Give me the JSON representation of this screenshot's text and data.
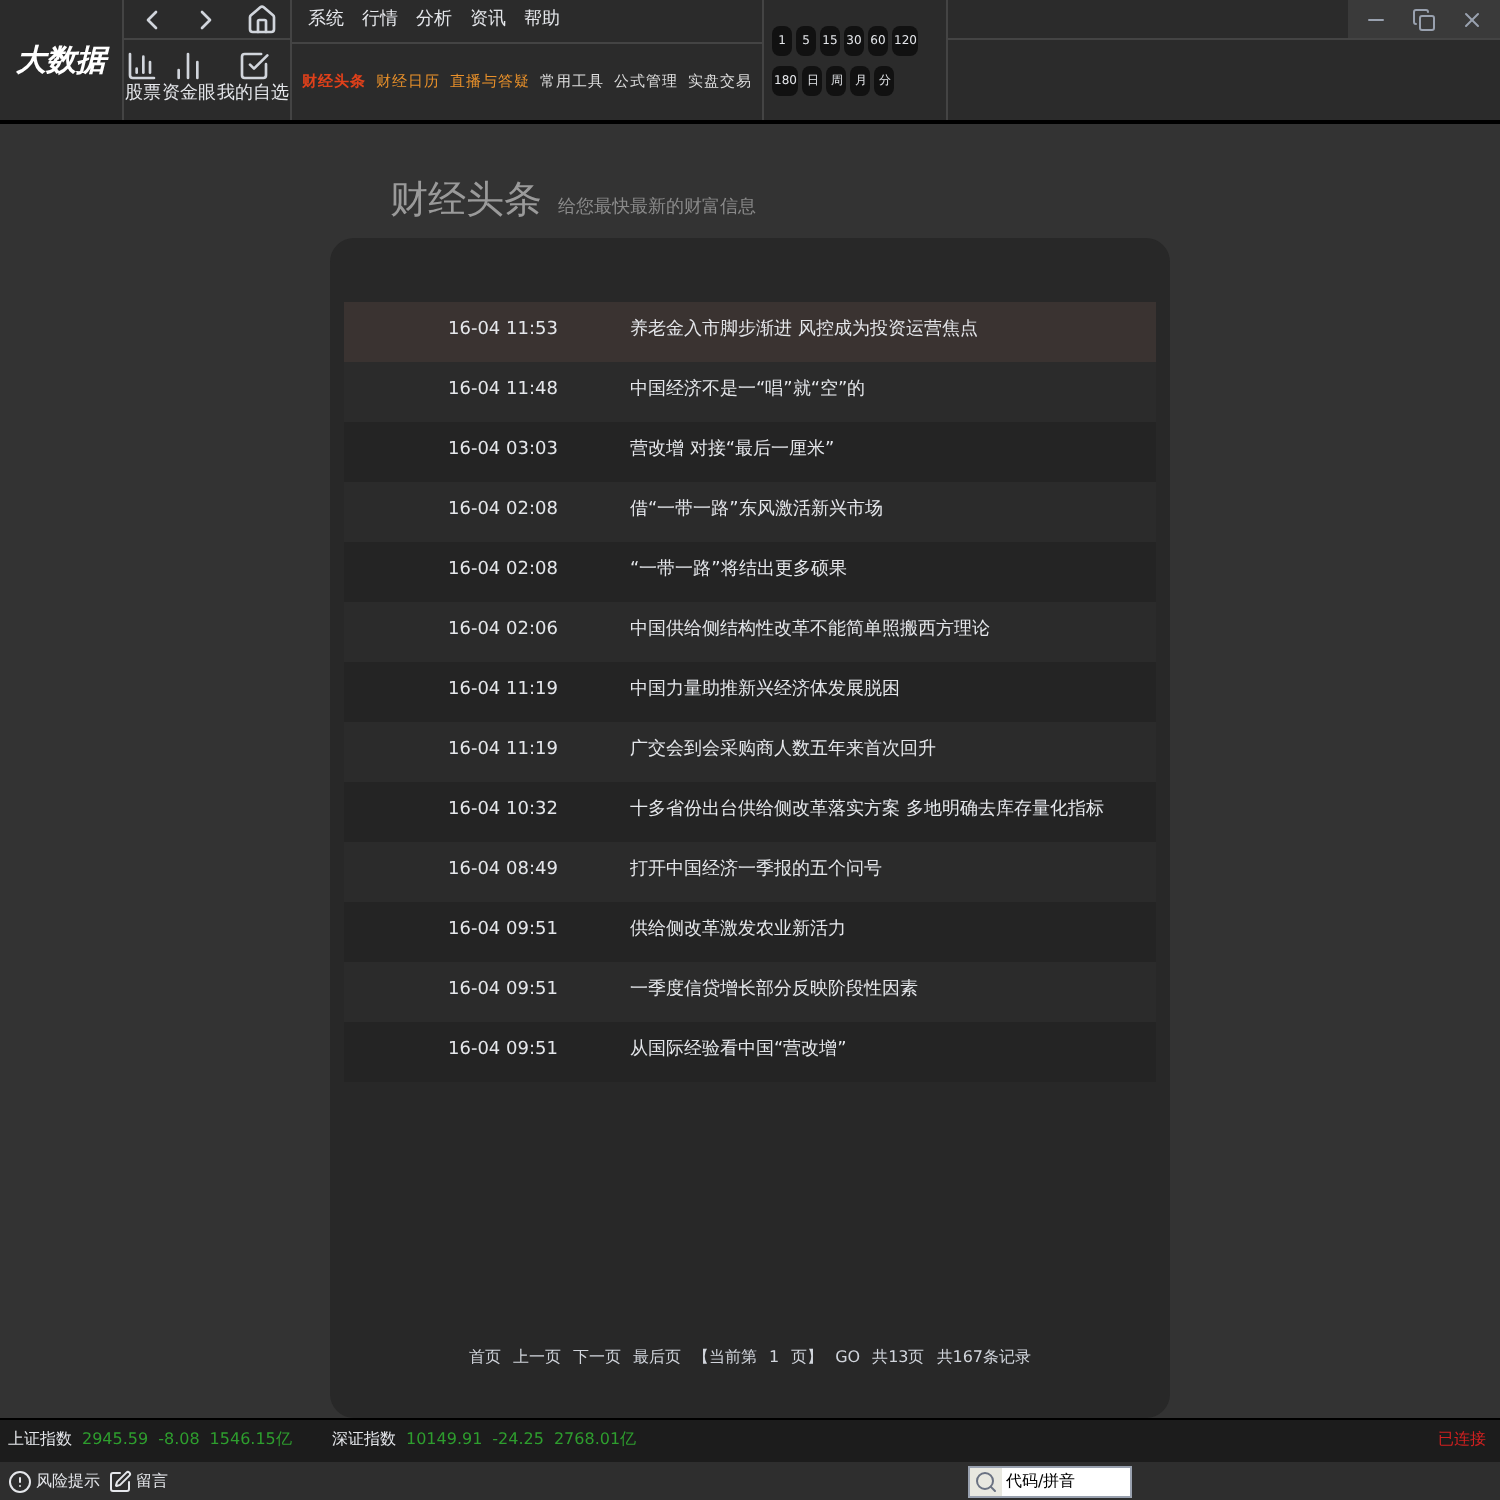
{
  "logo": {
    "text": "大数据"
  },
  "quick_icons": [
    {
      "kind": "back"
    },
    {
      "kind": "forward"
    },
    {
      "kind": "home"
    }
  ],
  "shortcuts": [
    {
      "kind": "stock",
      "label": "股票"
    },
    {
      "kind": "fund",
      "label": "资金眼"
    },
    {
      "kind": "watch",
      "label": "我的自选"
    }
  ],
  "menu": [
    "系统",
    "行情",
    "分析",
    "资讯",
    "帮助"
  ],
  "nav": [
    {
      "label": "财经头条",
      "selected": true,
      "color": "#e0401a"
    },
    {
      "label": "财经日历",
      "selected": false,
      "color": "#e8902a"
    },
    {
      "label": "直播与答疑",
      "selected": false,
      "color": "#e8902a"
    },
    {
      "label": "常用工具",
      "selected": false,
      "color": "#dddddd"
    },
    {
      "label": "公式管理",
      "selected": false,
      "color": "#dddddd"
    },
    {
      "label": "实盘交易",
      "selected": false,
      "color": "#dddddd"
    }
  ],
  "periods": [
    "1",
    "5",
    "15",
    "30",
    "60",
    "120",
    "180",
    "日",
    "周",
    "月",
    "分"
  ],
  "window_controls": [
    {
      "kind": "minimize"
    },
    {
      "kind": "restore"
    },
    {
      "kind": "close"
    }
  ],
  "page": {
    "title": "财经头条",
    "subtitle": "给您最快最新的财富信息"
  },
  "news": [
    {
      "time": "16-04 11:53",
      "headline": "养老金入市脚步渐进 风控成为投资运营焦点",
      "selected": true
    },
    {
      "time": "16-04 11:48",
      "headline": "中国经济不是一“唱”就“空”的",
      "selected": false
    },
    {
      "time": "16-04 03:03",
      "headline": "营改增 对接“最后一厘米”",
      "selected": false
    },
    {
      "time": "16-04 02:08",
      "headline": "借“一带一路”东风激活新兴市场",
      "selected": false
    },
    {
      "time": "16-04 02:08",
      "headline": "“一带一路”将结出更多硕果",
      "selected": false
    },
    {
      "time": "16-04 02:06",
      "headline": "中国供给侧结构性改革不能简单照搬西方理论",
      "selected": false
    },
    {
      "time": "16-04 11:19",
      "headline": "中国力量助推新兴经济体发展脱困",
      "selected": false
    },
    {
      "time": "16-04 11:19",
      "headline": "广交会到会采购商人数五年来首次回升",
      "selected": false
    },
    {
      "time": "16-04 10:32",
      "headline": "十多省份出台供给侧改革落实方案 多地明确去库存量化指标",
      "selected": false
    },
    {
      "time": "16-04 08:49",
      "headline": "打开中国经济一季报的五个问号",
      "selected": false
    },
    {
      "time": "16-04 09:51",
      "headline": "供给侧改革激发农业新活力",
      "selected": false
    },
    {
      "time": "16-04 09:51",
      "headline": "一季度信贷增长部分反映阶段性因素",
      "selected": false
    },
    {
      "time": "16-04 09:51",
      "headline": "从国际经验看中国“营改增”",
      "selected": false
    }
  ],
  "pagination": {
    "first": "首页",
    "prev": "上一页",
    "next": "下一页",
    "last": "最后页",
    "current_prefix": "【当前第",
    "current_page": "1",
    "current_suffix": "页】",
    "go": "GO",
    "total_pages": "共13页",
    "total_records": "共167条记录"
  },
  "indices": [
    {
      "name": "上证指数",
      "value": "2945.59",
      "change": "-8.08",
      "volume": "1546.15亿"
    },
    {
      "name": "深证指数",
      "value": "10149.91",
      "change": "-24.25",
      "volume": "2768.01亿"
    }
  ],
  "connection": "已连接",
  "bottom_links": [
    {
      "kind": "warning",
      "label": "风险提示"
    },
    {
      "kind": "edit",
      "label": "留言"
    }
  ],
  "search": {
    "placeholder": "代码/拼音"
  }
}
